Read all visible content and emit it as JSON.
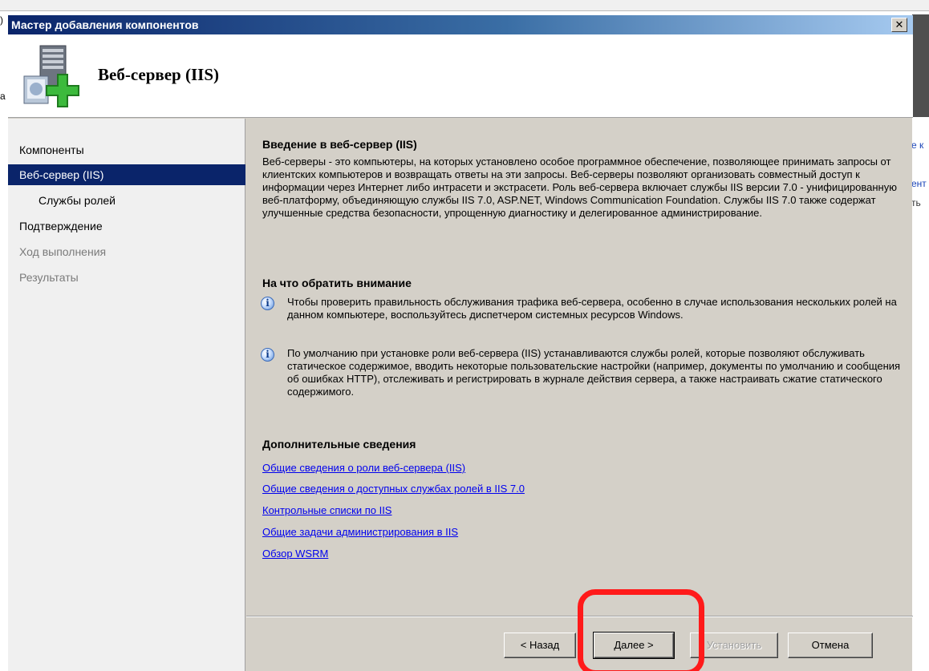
{
  "window": {
    "title": "Мастер добавления компонентов",
    "close_label": "✕"
  },
  "header": {
    "title": "Веб-сервер (IIS)"
  },
  "background": {
    "right_items": [
      "е к",
      "ент",
      "ть"
    ],
    "left_glyphs": [
      ")",
      "а"
    ]
  },
  "sidebar": {
    "items": [
      {
        "label": "Компоненты",
        "state": "normal"
      },
      {
        "label": "Веб-сервер (IIS)",
        "state": "active"
      },
      {
        "label": "Службы ролей",
        "state": "sub"
      },
      {
        "label": "Подтверждение",
        "state": "normal"
      },
      {
        "label": "Ход выполнения",
        "state": "disabled"
      },
      {
        "label": "Результаты",
        "state": "disabled"
      }
    ]
  },
  "content": {
    "intro_heading": "Введение в веб-сервер (IIS)",
    "intro_text": "Веб-серверы - это компьютеры, на которых установлено особое программное обеспечение, позволяющее принимать запросы от клиентских компьютеров и возвращать ответы на эти запросы. Веб-серверы позволяют организовать совместный доступ к информации через Интернет либо интрасети и экстрасети. Роль веб-сервера включает службы IIS версии 7.0 - унифицированную веб-платформу, объединяющую службы IIS 7.0, ASP.NET, Windows Communication Foundation. Службы IIS 7.0 также содержат улучшенные средства безопасности, упрощенную диагностику и делегированное администрирование.",
    "notes_heading": "На что обратить внимание",
    "notes": [
      "Чтобы проверить правильность обслуживания трафика веб-сервера, особенно в случае использования нескольких ролей на данном компьютере, воспользуйтесь диспетчером системных ресурсов Windows.",
      "По умолчанию при установке роли веб-сервера (IIS) устанавливаются службы ролей, которые позволяют обслуживать статическое содержимое, вводить некоторые пользовательские настройки (например, документы по умолчанию и сообщения об ошибках HTTP), отслеживать и регистрировать в журнале действия сервера, а также настраивать сжатие статического содержимого."
    ],
    "more_heading": "Дополнительные сведения",
    "links": [
      "Общие сведения о роли веб-сервера (IIS)",
      "Общие сведения о доступных службах ролей в IIS 7.0",
      "Контрольные списки по IIS",
      "Общие задачи администрирования в IIS",
      "Обзор WSRM"
    ]
  },
  "buttons": {
    "back": "< Назад",
    "next": "Далее >",
    "install": "Установить",
    "cancel": "Отмена"
  },
  "colors": {
    "highlight": "#ff1a1a",
    "active_nav": "#0a246a",
    "link": "#0000ee"
  }
}
